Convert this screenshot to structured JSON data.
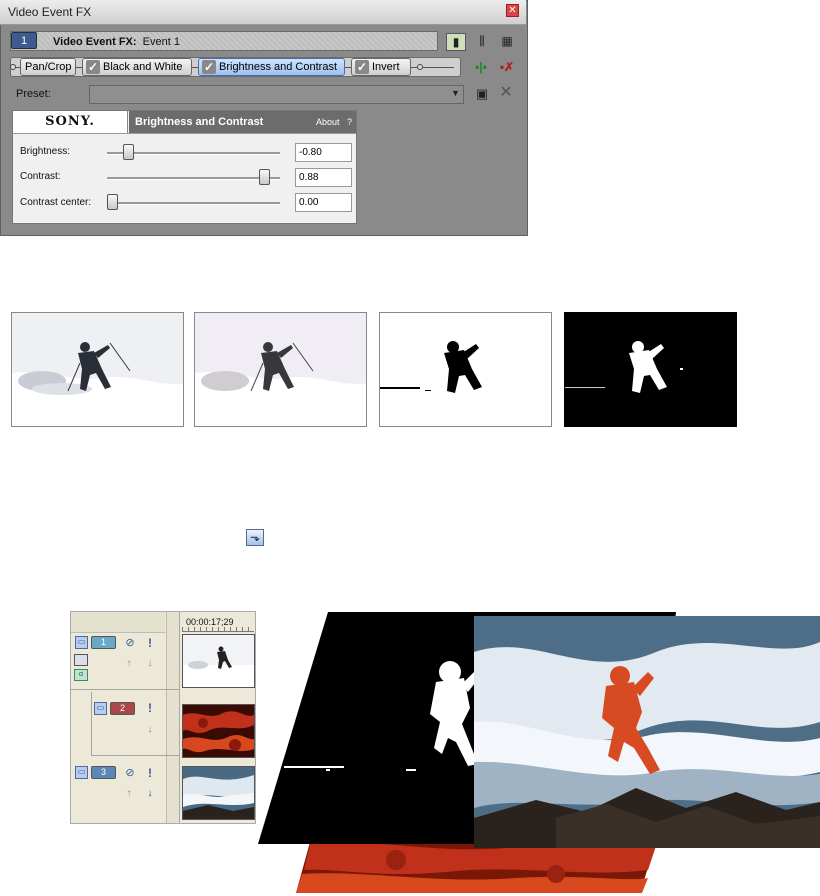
{
  "fx_window": {
    "title": "Video Event FX",
    "close_glyph": "✕",
    "event_number": "1",
    "event_label_bold": "Video Event FX:",
    "event_label": "Event 1",
    "view_buttons": [
      "▮",
      "⫼",
      "▦"
    ],
    "chain": [
      {
        "label": "Pan/Crop",
        "checked": false,
        "selected": false
      },
      {
        "label": "Black and White",
        "checked": true,
        "selected": false
      },
      {
        "label": "Brightness and Contrast",
        "checked": true,
        "selected": true
      },
      {
        "label": "Invert",
        "checked": true,
        "selected": false
      }
    ],
    "check_glyph": "✓",
    "chain_icons": {
      "add": "•|•",
      "remove": "•✗"
    },
    "preset": {
      "label": "Preset:",
      "value": "",
      "arrow": "▼",
      "save_glyph": "▣",
      "delete_glyph": "✕"
    },
    "plugin": {
      "logo": "SONY.",
      "name": "Brightness and Contrast",
      "about": "About",
      "help": "?",
      "params": [
        {
          "label": "Brightness:",
          "value": "-0.80",
          "level": 0.1
        },
        {
          "label": "Contrast:",
          "value": "0.88",
          "level": 0.94
        },
        {
          "label": "Contrast center:",
          "value": "0.00",
          "level": 0.0
        }
      ]
    }
  },
  "thumbnails": [
    {
      "name": "original",
      "variant": "original"
    },
    {
      "name": "black-and-white",
      "variant": "bw"
    },
    {
      "name": "brightness-contrast",
      "variant": "contrast"
    },
    {
      "name": "inverted",
      "variant": "invert"
    }
  ],
  "transport_button": {
    "icon": "move-down-icon",
    "glyph": "⬎"
  },
  "timeline": {
    "timecode": "00:00:17;29",
    "tracks": [
      {
        "number": "1",
        "color": "#6aa8c8",
        "has_mute": true,
        "has_solo": true
      },
      {
        "number": "2",
        "color": "#a84848",
        "has_mute": false,
        "has_solo": true
      },
      {
        "number": "3",
        "color": "#5a86b8",
        "has_mute": true,
        "has_solo": true
      }
    ],
    "glyphs": {
      "minimize": "▭",
      "mute": "⊘",
      "solo": "!",
      "up": "↑",
      "down": "↓"
    }
  },
  "colors": {
    "window_bg": "#8a8a8a",
    "selected_plugin": "#9ec0ee",
    "fire": "#c0301a",
    "ocean": "#5a7890"
  }
}
